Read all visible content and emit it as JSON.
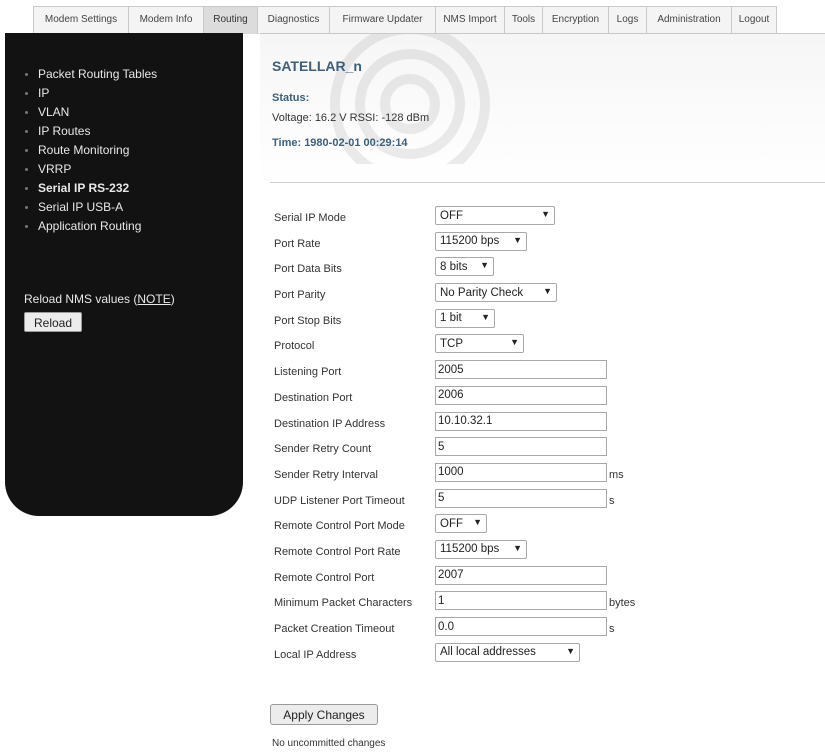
{
  "tabs": [
    {
      "label": "Modem Settings",
      "w": 96
    },
    {
      "label": "Modem Info",
      "w": 76
    },
    {
      "label": "Routing",
      "w": 55,
      "active": true
    },
    {
      "label": "Diagnostics",
      "w": 73
    },
    {
      "label": "Firmware Updater",
      "w": 107
    },
    {
      "label": "NMS Import",
      "w": 70
    },
    {
      "label": "Tools",
      "w": 39
    },
    {
      "label": "Encryption",
      "w": 67
    },
    {
      "label": "Logs",
      "w": 39
    },
    {
      "label": "Administration",
      "w": 86
    },
    {
      "label": "Logout",
      "w": 46
    }
  ],
  "sidebar": {
    "items": [
      {
        "label": "Packet Routing Tables"
      },
      {
        "label": "IP"
      },
      {
        "label": "VLAN"
      },
      {
        "label": "IP Routes"
      },
      {
        "label": "Route Monitoring"
      },
      {
        "label": "VRRP"
      },
      {
        "label": "Serial IP RS-232",
        "bold": true
      },
      {
        "label": "Serial IP USB-A"
      },
      {
        "label": "Application Routing"
      }
    ],
    "reload_text": "Reload NMS values (",
    "reload_note": "NOTE",
    "reload_text_end": ")",
    "reload_button": "Reload"
  },
  "header": {
    "device_name": "SATELLAR_n",
    "status_label": "Status:",
    "status_line": "Voltage: 16.2 V RSSI: -128 dBm",
    "time_line": "Time: 1980-02-01 00:29:14"
  },
  "form": {
    "fields": [
      {
        "label": "Serial IP Mode",
        "type": "select",
        "value": "OFF",
        "w": 120
      },
      {
        "label": "Port Rate",
        "type": "select",
        "value": "115200 bps",
        "w": 92
      },
      {
        "label": "Port Data Bits",
        "type": "select",
        "value": "8 bits",
        "w": 59
      },
      {
        "label": "Port Parity",
        "type": "select",
        "value": "No Parity Check",
        "w": 122
      },
      {
        "label": "Port Stop Bits",
        "type": "select",
        "value": "1 bit",
        "w": 60
      },
      {
        "label": "Protocol",
        "type": "select",
        "value": "TCP",
        "w": 89
      },
      {
        "label": "Listening Port",
        "type": "input",
        "value": "2005"
      },
      {
        "label": "Destination Port",
        "type": "input",
        "value": "2006"
      },
      {
        "label": "Destination IP Address",
        "type": "input",
        "value": "10.10.32.1"
      },
      {
        "label": "Sender Retry Count",
        "type": "input",
        "value": "5"
      },
      {
        "label": "Sender Retry Interval",
        "type": "input",
        "value": "1000",
        "unit": "ms"
      },
      {
        "label": "UDP Listener Port Timeout",
        "type": "input",
        "value": "5",
        "unit": "s"
      },
      {
        "label": "Remote Control Port Mode",
        "type": "select",
        "value": "OFF",
        "w": 52
      },
      {
        "label": "Remote Control Port Rate",
        "type": "select",
        "value": "115200 bps",
        "w": 92
      },
      {
        "label": "Remote Control Port",
        "type": "input",
        "value": "2007"
      },
      {
        "label": "Minimum Packet Characters",
        "type": "input",
        "value": "1",
        "unit": "bytes"
      },
      {
        "label": "Packet Creation Timeout",
        "type": "input",
        "value": "0.0",
        "unit": "s"
      },
      {
        "label": "Local IP Address",
        "type": "select",
        "value": "All local addresses",
        "w": 145
      }
    ],
    "apply_button": "Apply Changes",
    "status_message": "No uncommitted changes"
  }
}
